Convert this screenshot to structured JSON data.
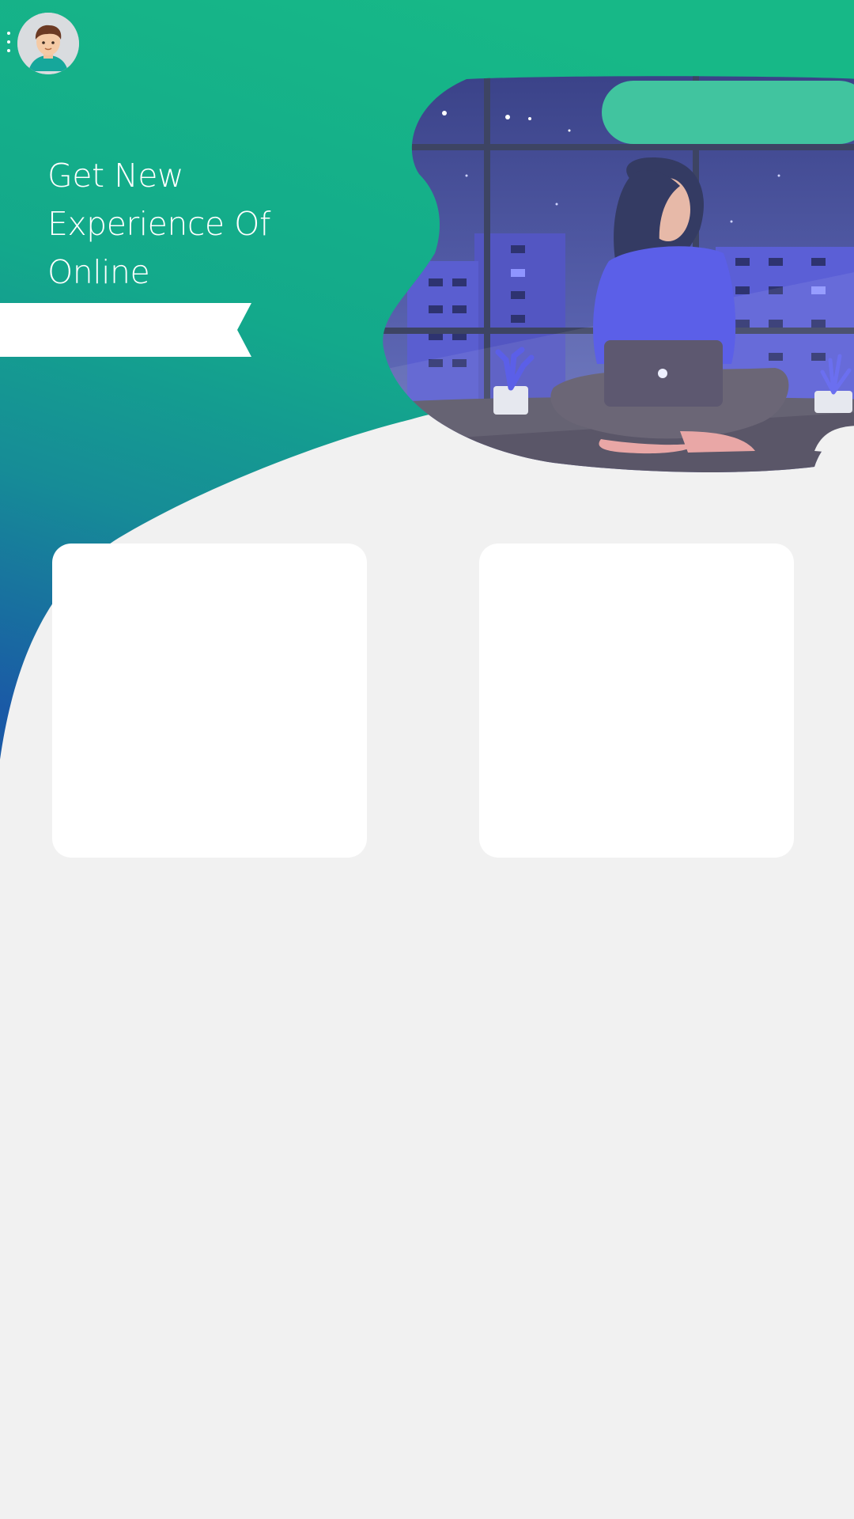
{
  "header": {
    "menu_icon": "more-vert-icon",
    "avatar_icon": "user-avatar"
  },
  "hero": {
    "headline_lines": [
      "Get New",
      "Experience Of",
      "Online"
    ],
    "illustration": "woman-with-laptop-at-night-window"
  },
  "colors": {
    "gradient_top": "#16b887",
    "gradient_mid": "#12a38e",
    "gradient_bottom": "#1a5fa6",
    "pill": "#41c49f",
    "page_bg": "#f1f1f1",
    "card_bg": "#ffffff",
    "night_sky": "#4a4f9a",
    "accent_purple": "#5b5fe8"
  },
  "cards": [
    {
      "id": "left",
      "label": ""
    },
    {
      "id": "right",
      "label": ""
    }
  ]
}
